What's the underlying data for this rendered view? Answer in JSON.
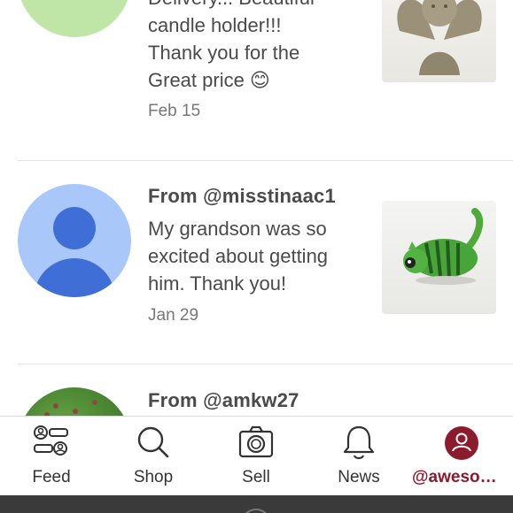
{
  "reviews": [
    {
      "from": "",
      "message_lines": [
        "Delivery... Beautiful",
        "candle holder!!!",
        "Thank you for the",
        "Great price 😊"
      ],
      "date": "Feb 15",
      "avatar": "green-avatar",
      "thumbnail": "angel-candle-holder"
    },
    {
      "from": "From @misstinaac1",
      "message_lines": [
        "My grandson was so",
        "excited about getting",
        "him. Thank you!"
      ],
      "date": "Jan 29",
      "avatar": "default-user-avatar",
      "thumbnail": "green-cat-figurine"
    },
    {
      "from": "From @amkw27",
      "message_lines": [],
      "date": "",
      "avatar": "photo-avatar",
      "thumbnail": ""
    }
  ],
  "tabbar": {
    "items": [
      {
        "label": "Feed",
        "icon": "feed-icon"
      },
      {
        "label": "Shop",
        "icon": "search-icon"
      },
      {
        "label": "Sell",
        "icon": "camera-icon"
      },
      {
        "label": "News",
        "icon": "bell-icon"
      },
      {
        "label": "@awesome...",
        "icon": "profile-icon",
        "active": true
      }
    ]
  },
  "colors": {
    "accent": "#8c1b2e",
    "avatar_blue": "#3f6fd6",
    "avatar_blue_bg": "#a9c7f8",
    "avatar_green_bg": "#bfe6a6"
  }
}
